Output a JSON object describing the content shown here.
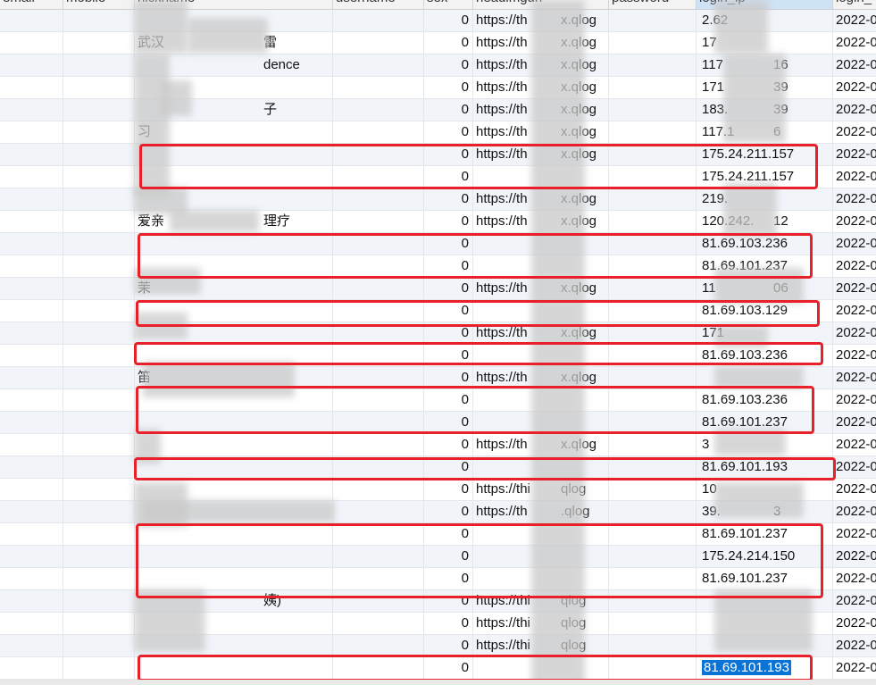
{
  "columns": [
    "email",
    "mobile",
    "nickname",
    "username",
    "sex",
    "headimgurl",
    "password",
    "login_ip",
    "login_"
  ],
  "rows": [
    {
      "nickname": "",
      "sex": "0",
      "headimgurl": "https://th",
      "headimgurl_tail": "x.qlog",
      "login_ip": "2.62",
      "login_time": "2022-0"
    },
    {
      "nickname": "武汉",
      "nickname_tail": "雷",
      "sex": "0",
      "headimgurl": "https://th",
      "headimgurl_tail": "x.qlog",
      "login_ip": "17",
      "login_time": "2022-0"
    },
    {
      "nickname": "",
      "nickname_tail": "dence",
      "sex": "0",
      "headimgurl": "https://th",
      "headimgurl_tail": "x.qlog",
      "login_ip": "117",
      "login_ip_tail": "16",
      "login_time": "2022-0"
    },
    {
      "nickname": "",
      "sex": "0",
      "headimgurl": "https://th",
      "headimgurl_tail": "x.qlog",
      "login_ip": "171",
      "login_ip_tail": "39",
      "login_time": "2022-0"
    },
    {
      "nickname": "",
      "nickname_tail": "子",
      "sex": "0",
      "headimgurl": "https://th",
      "headimgurl_tail": "x.qlog",
      "login_ip": "183.",
      "login_ip_tail": "39",
      "login_time": "2022-0"
    },
    {
      "nickname": "习",
      "sex": "0",
      "headimgurl": "https://th",
      "headimgurl_tail": "x.qlog",
      "login_ip": "117.1",
      "login_ip_tail": "6",
      "login_time": "2022-0"
    },
    {
      "nickname": "",
      "sex": "0",
      "headimgurl": "https://th",
      "headimgurl_tail": "x.qlog",
      "login_ip": "175.24.211.157",
      "login_time": "2022-0"
    },
    {
      "nickname": "",
      "sex": "0",
      "headimgurl": "",
      "login_ip": "175.24.211.157",
      "login_time": "2022-0"
    },
    {
      "nickname": "",
      "sex": "0",
      "headimgurl": "https://th",
      "headimgurl_tail": "x.qlog",
      "login_ip": "219.",
      "login_time": "2022-0"
    },
    {
      "nickname": "爱亲",
      "nickname_tail": "理疗",
      "sex": "0",
      "headimgurl": "https://th",
      "headimgurl_tail": "x.qlog",
      "login_ip": "120.242.",
      "login_ip_tail": "12",
      "login_time": "2022-0"
    },
    {
      "nickname": "",
      "sex": "0",
      "headimgurl": "",
      "login_ip": "81.69.103.236",
      "login_time": "2022-0"
    },
    {
      "nickname": "",
      "sex": "0",
      "headimgurl": "",
      "login_ip": "81.69.101.237",
      "login_time": "2022-0"
    },
    {
      "nickname": "茉",
      "sex": "0",
      "headimgurl": "https://th",
      "headimgurl_tail": "x.qlog",
      "login_ip": "11",
      "login_ip_tail": "06",
      "login_time": "2022-0"
    },
    {
      "nickname": "",
      "sex": "0",
      "headimgurl": "",
      "login_ip": "81.69.103.129",
      "login_time": "2022-0"
    },
    {
      "nickname": "",
      "sex": "0",
      "headimgurl": "https://th",
      "headimgurl_tail": "x.qlog",
      "login_ip": "171",
      "login_time": "2022-0"
    },
    {
      "nickname": "",
      "sex": "0",
      "headimgurl": "",
      "login_ip": "81.69.103.236",
      "login_time": "2022-0"
    },
    {
      "nickname": "笛",
      "sex": "0",
      "headimgurl": "https://th",
      "headimgurl_tail": "x.qlog",
      "login_ip": "",
      "login_time": "2022-0"
    },
    {
      "nickname": "",
      "sex": "0",
      "headimgurl": "",
      "login_ip": "81.69.103.236",
      "login_time": "2022-0"
    },
    {
      "nickname": "",
      "sex": "0",
      "headimgurl": "",
      "login_ip": "81.69.101.237",
      "login_time": "2022-0"
    },
    {
      "nickname": "",
      "sex": "0",
      "headimgurl": "https://th",
      "headimgurl_tail": "x.qlog",
      "login_ip": "3",
      "login_time": "2022-0"
    },
    {
      "nickname": "",
      "sex": "0",
      "headimgurl": "",
      "login_ip": "81.69.101.193",
      "login_time": "2022-0"
    },
    {
      "nickname": "",
      "sex": "0",
      "headimgurl": "https://thi",
      "headimgurl_tail": "qlog",
      "login_ip": "10",
      "login_time": "2022-0"
    },
    {
      "nickname": "",
      "sex": "0",
      "headimgurl": "https://th",
      "headimgurl_tail": ".qlog",
      "login_ip": "39.",
      "login_ip_tail": "3",
      "login_time": "2022-0"
    },
    {
      "nickname": "",
      "sex": "0",
      "headimgurl": "",
      "login_ip": "81.69.101.237",
      "login_time": "2022-0"
    },
    {
      "nickname": "",
      "sex": "0",
      "headimgurl": "",
      "login_ip": "175.24.214.150",
      "login_time": "2022-0"
    },
    {
      "nickname": "",
      "sex": "0",
      "headimgurl": "",
      "login_ip": "81.69.101.237",
      "login_time": "2022-0"
    },
    {
      "nickname": "",
      "nickname_tail": "姨)",
      "sex": "0",
      "headimgurl": "https://thi",
      "headimgurl_tail": "qlog",
      "login_ip": "",
      "login_time": "2022-0"
    },
    {
      "nickname": "",
      "sex": "0",
      "headimgurl": "https://thi",
      "headimgurl_tail": "qlog",
      "login_ip": "",
      "login_time": "2022-0"
    },
    {
      "nickname": "",
      "sex": "0",
      "headimgurl": "https://thi",
      "headimgurl_tail": "qlog",
      "login_ip": "",
      "login_time": "2022-0"
    },
    {
      "nickname": "",
      "sex": "0",
      "headimgurl": "",
      "login_ip": "81.69.101.193",
      "login_time": "2022-0",
      "selected": true
    }
  ],
  "highlight_color": "#e8202a",
  "selection_color": "#0a74d6"
}
